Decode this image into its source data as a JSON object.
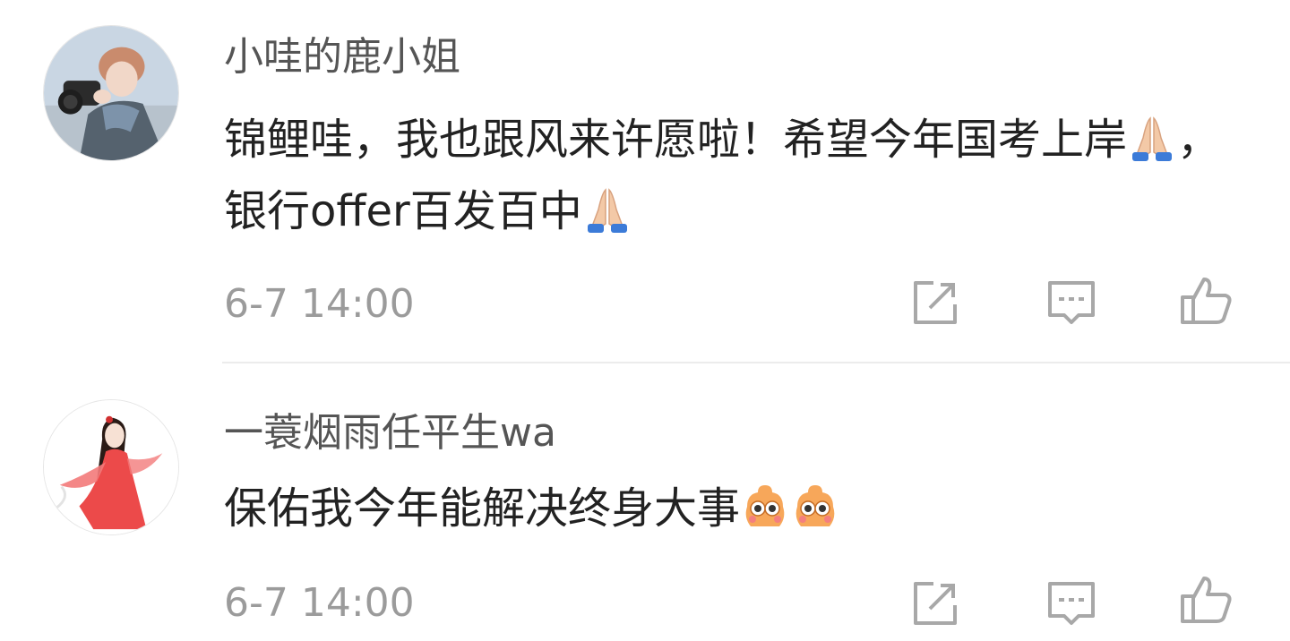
{
  "comments": [
    {
      "username": "小哇的鹿小姐",
      "text_parts": [
        "锦鲤哇，我也跟风来许愿啦！希望今年国考上岸",
        "，银行offer百发百中"
      ],
      "emoji": "folded-hands-emoji",
      "timestamp": "6-7 14:00",
      "actions": [
        "share-icon",
        "comment-icon",
        "like-icon"
      ]
    },
    {
      "username": "一蓑烟雨任平生wa",
      "text_parts": [
        "保佑我今年能解决终身大事"
      ],
      "emoji": "hopeful-face-emoji",
      "timestamp": "6-7 14:00",
      "actions": [
        "share-icon",
        "comment-icon",
        "like-icon"
      ]
    }
  ],
  "colors": {
    "username": "#555555",
    "text": "#222222",
    "meta": "#9b9b9b",
    "icon": "#a8a8a8",
    "divider": "#ececec"
  }
}
